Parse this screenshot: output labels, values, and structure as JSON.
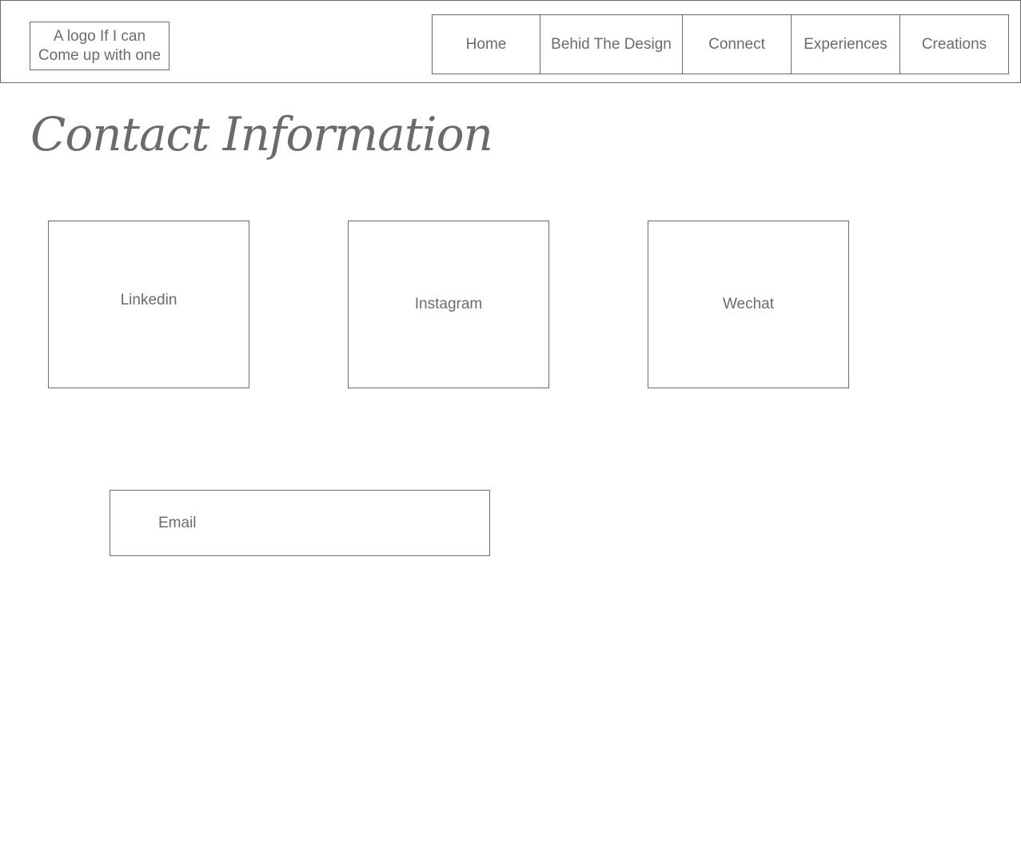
{
  "header": {
    "logo_line1": "A logo If I can",
    "logo_line2": "Come up with one",
    "nav": [
      {
        "label": "Home"
      },
      {
        "label": "Behid The Design"
      },
      {
        "label": "Connect"
      },
      {
        "label": "Experiences"
      },
      {
        "label": "Creations"
      }
    ]
  },
  "main": {
    "title": "Contact Information",
    "cards": [
      {
        "label": "Linkedin"
      },
      {
        "label": "Instagram"
      },
      {
        "label": "Wechat"
      }
    ],
    "email_label": "Email"
  },
  "colors": {
    "line": "#6b6b6b",
    "text": "#6b6b6b",
    "background": "#ffffff"
  }
}
